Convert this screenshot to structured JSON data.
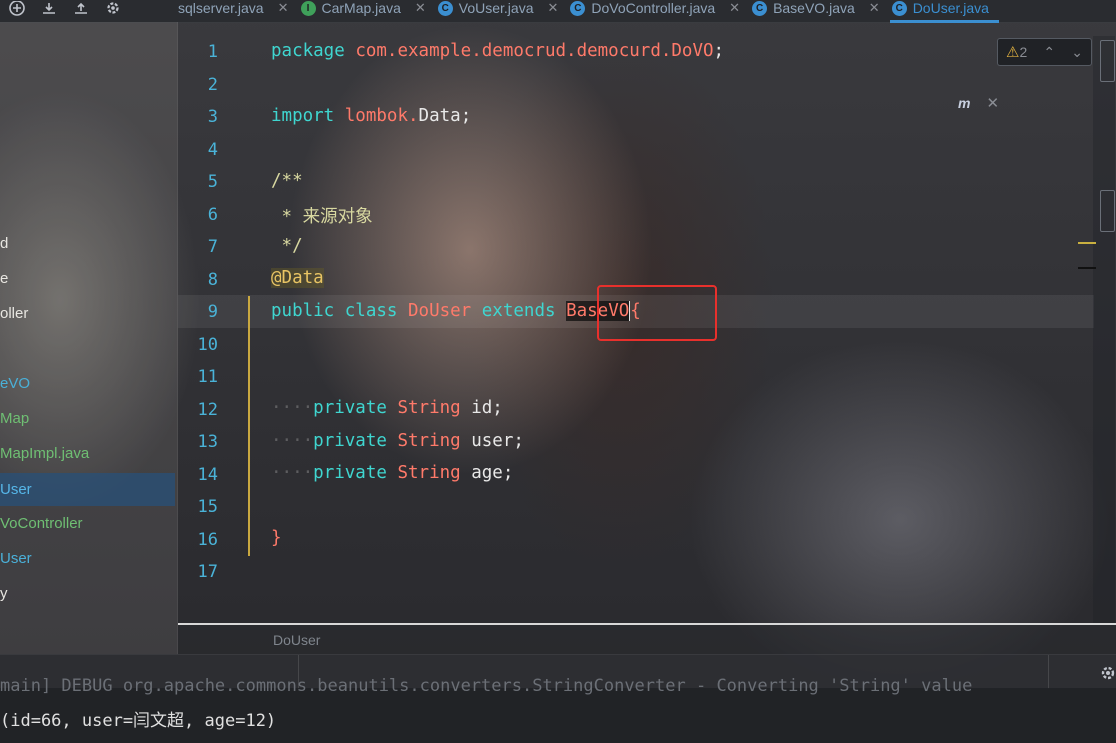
{
  "tabs": [
    {
      "label": "sqlserver.java",
      "icon": "none"
    },
    {
      "label": "CarMap.java",
      "icon": "interface-icon"
    },
    {
      "label": "VoUser.java",
      "icon": "class-icon"
    },
    {
      "label": "DoVoController.java",
      "icon": "class-icon"
    },
    {
      "label": "BaseVO.java",
      "icon": "class-icon"
    },
    {
      "label": "DoUser.java",
      "icon": "class-icon",
      "active": true
    }
  ],
  "sidebar": {
    "items": [
      {
        "label": "d",
        "style": "plain"
      },
      {
        "label": "e",
        "style": "plain"
      },
      {
        "label": "oller",
        "style": "plain"
      },
      {
        "label": "eVO",
        "style": "cyan"
      },
      {
        "label": "Map",
        "style": "green"
      },
      {
        "label": "MapImpl.java",
        "style": "green"
      },
      {
        "label": "User",
        "style": "selected"
      },
      {
        "label": "VoController",
        "style": "green"
      },
      {
        "label": "User",
        "style": "cyan"
      },
      {
        "label": "y",
        "style": "plain"
      }
    ]
  },
  "editor": {
    "line_numbers": [
      "1",
      "2",
      "3",
      "4",
      "5",
      "6",
      "7",
      "8",
      "9",
      "10",
      "11",
      "12",
      "13",
      "14",
      "15",
      "16",
      "17"
    ],
    "code": {
      "l1_kw": "package",
      "l1_pkg": "com.example.democrud.democurd.DoVO",
      "l1_end": ";",
      "l3_kw": "import",
      "l3_pkg": "lombok.",
      "l3_cls": "Data",
      "l3_end": ";",
      "l5": "/**",
      "l6": " * 来源对象",
      "l7": " */",
      "l8": "@Data",
      "l9_kw1": "public",
      "l9_kw2": "class",
      "l9_name": "DoUser",
      "l9_kw3": "extends",
      "l9_base": "BaseVO",
      "l9_brace": "{",
      "l12_kw": "private",
      "l12_type": "String",
      "l12_var": "id;",
      "l13_kw": "private",
      "l13_type": "String",
      "l13_var": "user;",
      "l14_kw": "private",
      "l14_type": "String",
      "l14_var": "age;",
      "l16": "}"
    },
    "inspection": {
      "warnings": "2"
    },
    "maven_label": "m"
  },
  "breadcrumb": {
    "item": "DoUser"
  },
  "console": {
    "log_line": "main] DEBUG org.apache.commons.beanutils.converters.StringConverter - Converting 'String' value",
    "output_line": "(id=66, user=闫文超, age=12)"
  },
  "colors": {
    "accent": "#3b8fd1",
    "keyword": "#3fd6d0",
    "identifier": "#ff7a6a",
    "highlight_box": "#e8302c"
  }
}
